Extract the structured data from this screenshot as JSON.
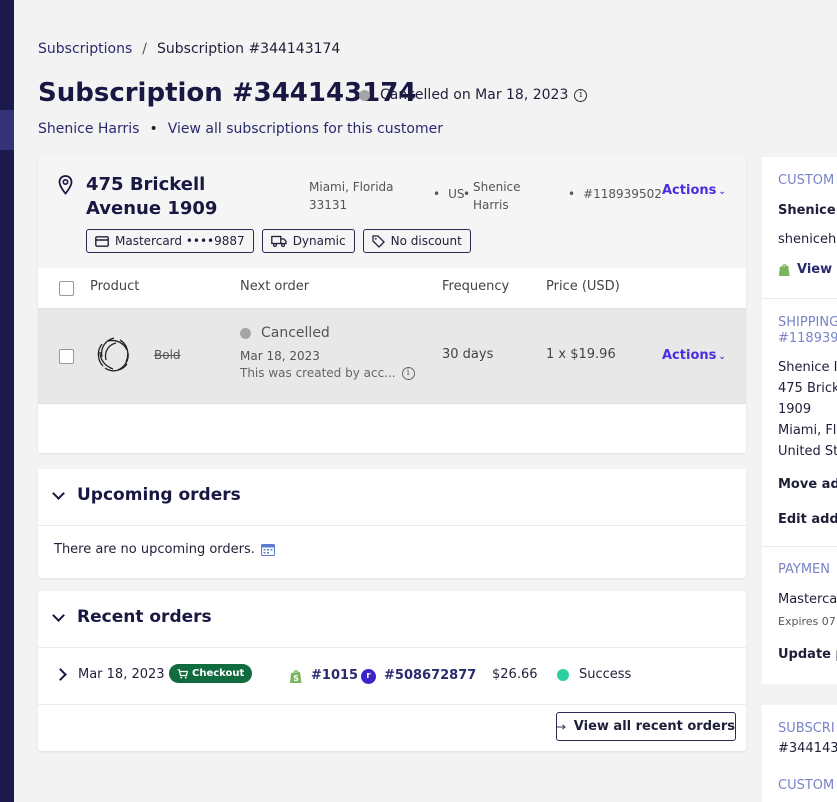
{
  "breadcrumb": {
    "root": "Subscriptions",
    "separator": "/",
    "current": "Subscription #344143174"
  },
  "header": {
    "title": "Subscription #344143174",
    "status": "Cancelled on Mar 18, 2023",
    "customer_name": "Shenice Harris",
    "view_all_link": "View all subscriptions for this customer"
  },
  "address": {
    "street": "475 Brickell Avenue 1909",
    "city_state_zip": "Miami, Florida 33131",
    "country": "US",
    "name": "Shenice Harris",
    "id": "#118939502",
    "actions": "Actions"
  },
  "badges": {
    "payment": "Mastercard ••••9887",
    "shipping": "Dynamic",
    "discount": "No discount"
  },
  "table": {
    "headers": {
      "product": "Product",
      "next_order": "Next order",
      "frequency": "Frequency",
      "price": "Price (USD)"
    },
    "row": {
      "product": "Bold",
      "status": "Cancelled",
      "date": "Mar 18, 2023",
      "note": "This was created by acc...",
      "frequency": "30 days",
      "price": "1 x $19.96",
      "actions": "Actions"
    }
  },
  "upcoming": {
    "title": "Upcoming orders",
    "empty": "There are no upcoming orders."
  },
  "recent": {
    "title": "Recent orders",
    "order": {
      "date": "Mar 18, 2023",
      "tag": "Checkout",
      "shop_number": "#1015",
      "external_number": "#508672877",
      "amount": "$26.66",
      "status": "Success"
    },
    "view_all": "View all recent orders"
  },
  "sidebar": {
    "customer_heading": "CUSTOM",
    "customer_name": "Shenice I",
    "customer_email": "shenicehi",
    "view_link": "View",
    "shipping_heading_1": "SHIPPING",
    "shipping_heading_2": "#118939",
    "ship_name": "Shenice I",
    "ship_street": "475 Brick",
    "ship_unit": "1909",
    "ship_city": "Miami, Fl",
    "ship_country": "United St",
    "move_address": "Move add",
    "edit_address": "Edit addr",
    "payment_heading": "PAYMEN",
    "payment_card": "Mastercar",
    "payment_expires": "Expires 07",
    "update_payment": "Update p",
    "subscription_heading": "SUBSCRI",
    "subscription_id": "#344143",
    "customer_heading_2": "CUSTOM"
  },
  "colors": {
    "accent": "#4a2ee0",
    "brand_dark": "#181842",
    "success": "#2ecf9e",
    "checkout_tag": "#106b3e",
    "sidebar_heading": "#7a83c7"
  }
}
